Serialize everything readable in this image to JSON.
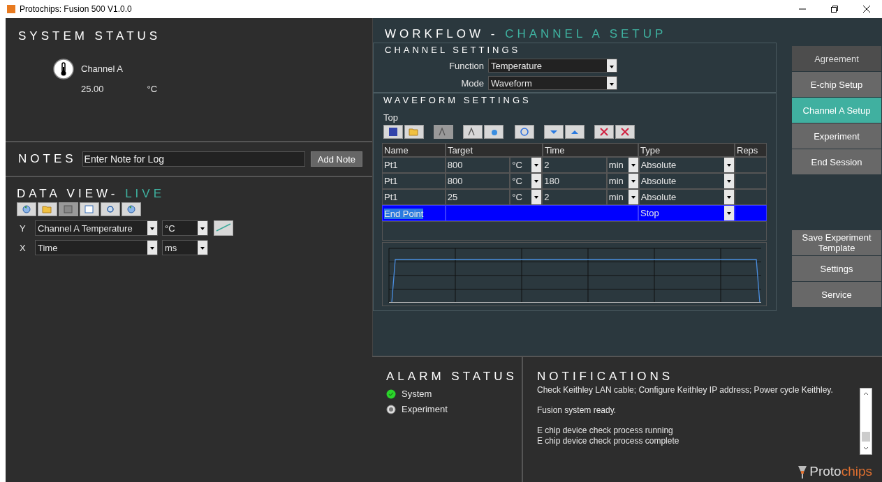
{
  "window": {
    "title": "Protochips: Fusion 500 V1.0.0"
  },
  "system_status": {
    "title": "SYSTEM STATUS",
    "channel": "Channel A",
    "value": "25.00",
    "unit": "°C"
  },
  "notes": {
    "title": "NOTES",
    "placeholder": "Enter Note for Log",
    "button": "Add Note"
  },
  "data_view": {
    "title": "DATA VIEW-",
    "highlight": "LIVE",
    "axes": [
      {
        "axis": "Y",
        "quantity": "Channel A Temperature",
        "unit": "°C",
        "line_style": true
      },
      {
        "axis": "X",
        "quantity": "Time",
        "unit": "ms",
        "line_style": false
      }
    ]
  },
  "workflow": {
    "title": "WORKFLOW -",
    "highlight": "CHANNEL A SETUP"
  },
  "channel_settings": {
    "title": "CHANNEL SETTINGS",
    "fields": [
      {
        "label": "Function",
        "value": "Temperature"
      },
      {
        "label": "Mode",
        "value": "Waveform"
      }
    ]
  },
  "waveform_settings": {
    "title": "WAVEFORM SETTINGS",
    "segment": "Top",
    "columns": [
      "Name",
      "Target",
      "Time",
      "Type",
      "Reps"
    ],
    "rows": [
      {
        "kind": "point",
        "name": "Pt1",
        "target": "800",
        "target_unit": "°C",
        "time": "2",
        "time_unit": "min",
        "type": "Absolute",
        "selected": false
      },
      {
        "kind": "point",
        "name": "Pt1",
        "target": "800",
        "target_unit": "°C",
        "time": "180",
        "time_unit": "min",
        "type": "Absolute",
        "selected": false
      },
      {
        "kind": "point",
        "name": "Pt1",
        "target": "25",
        "target_unit": "°C",
        "time": "2",
        "time_unit": "min",
        "type": "Absolute",
        "selected": false
      },
      {
        "kind": "end",
        "name": "End Point",
        "type": "Stop",
        "selected": true
      }
    ]
  },
  "navigation": [
    {
      "label": "Agreement",
      "selected": false,
      "disabled": true
    },
    {
      "label": "E-chip Setup",
      "selected": false,
      "disabled": false
    },
    {
      "label": "Channel A Setup",
      "selected": true,
      "disabled": false
    },
    {
      "label": "Experiment",
      "selected": false,
      "disabled": false
    },
    {
      "label": "End Session",
      "selected": false,
      "disabled": false
    }
  ],
  "tools_menu": [
    {
      "label": "Save Experiment Template"
    },
    {
      "label": "Settings"
    },
    {
      "label": "Service"
    }
  ],
  "alarm_status": {
    "title": "ALARM STATUS",
    "items": [
      {
        "label": "System",
        "kind": "ok"
      },
      {
        "label": "Experiment",
        "kind": "idle"
      }
    ]
  },
  "notifications": {
    "title": "NOTIFICATIONS",
    "messages": [
      {
        "lines": [
          "Check Keithley LAN cable; Configure Keithley IP address; Power cycle Keithley."
        ]
      },
      {
        "lines": [
          "Fusion system ready."
        ]
      },
      {
        "lines": [
          "E chip device check process running",
          "E chip device check process complete"
        ]
      }
    ]
  },
  "logo": {
    "first": "Proto",
    "second": "chips"
  }
}
